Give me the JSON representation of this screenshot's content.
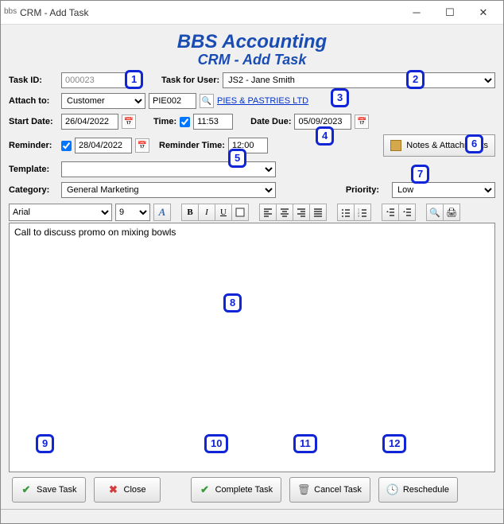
{
  "window": {
    "title": "CRM - Add Task",
    "app_icon": "bbs"
  },
  "header": {
    "title": "BBS Accounting",
    "subtitle": "CRM - Add Task"
  },
  "form": {
    "task_id_label": "Task ID:",
    "task_id_value": "000023",
    "task_for_user_label": "Task for User:",
    "task_for_user_value": "JS2 - Jane Smith",
    "attach_to_label": "Attach to:",
    "attach_to_value": "Customer",
    "attach_code": "PIE002",
    "attach_link": "PIES & PASTRIES LTD",
    "start_date_label": "Start Date:",
    "start_date_value": "26/04/2022",
    "time_label": "Time:",
    "time_value": "11:53",
    "date_due_label": "Date Due:",
    "date_due_value": "05/09/2023",
    "reminder_label": "Reminder:",
    "reminder_date": "28/04/2022",
    "reminder_time_label": "Reminder Time:",
    "reminder_time_value": "12:00",
    "template_label": "Template:",
    "template_value": "",
    "category_label": "Category:",
    "category_value": "General Marketing",
    "priority_label": "Priority:",
    "priority_value": "Low",
    "notes_btn": "Notes & Attachments"
  },
  "toolbar": {
    "font_name": "Arial",
    "font_size": "9",
    "bold": "B",
    "italic": "I",
    "underline": "U",
    "font_btn": "A"
  },
  "editor": {
    "text": "Call to discuss promo on mixing bowls"
  },
  "footer": {
    "save": "Save Task",
    "close": "Close",
    "complete": "Complete Task",
    "cancel": "Cancel Task",
    "reschedule": "Reschedule"
  },
  "callouts": [
    "1",
    "2",
    "3",
    "4",
    "5",
    "6",
    "7",
    "8",
    "9",
    "10",
    "11",
    "12"
  ]
}
